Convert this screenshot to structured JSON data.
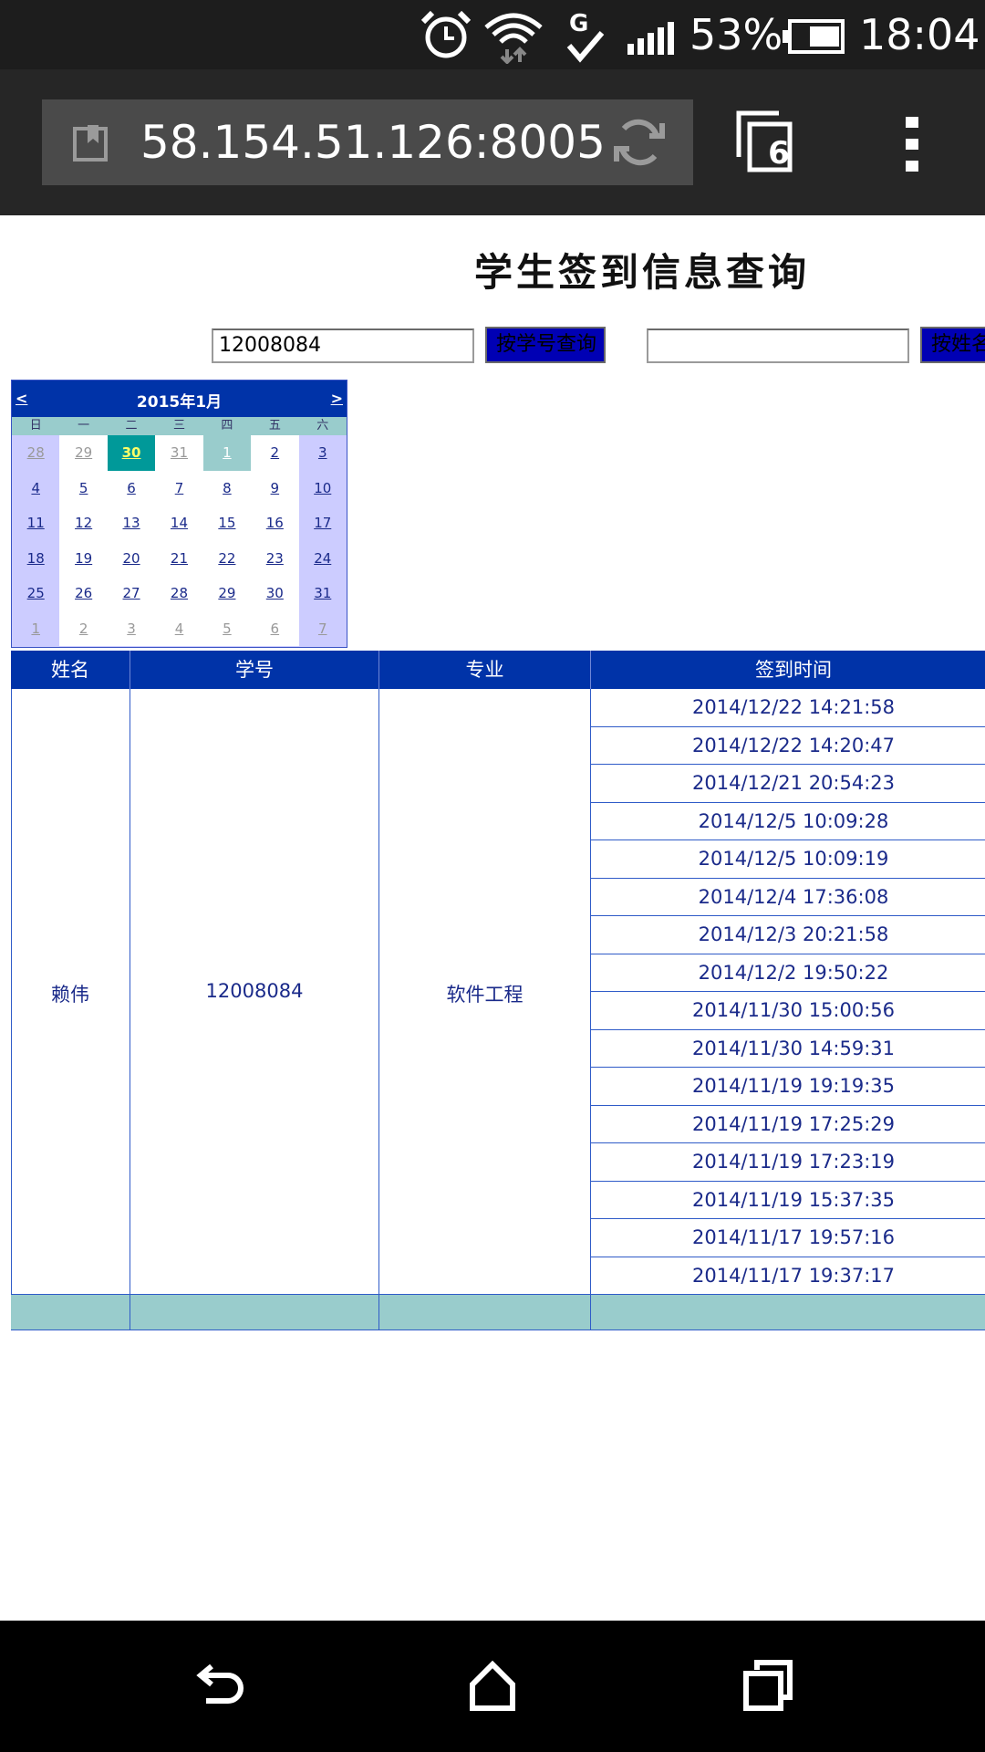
{
  "status_bar": {
    "battery_percent": "53%",
    "time": "18:04",
    "icons": [
      "alarm-icon",
      "wifi-icon",
      "g-data-icon",
      "signal-icon",
      "battery-icon"
    ]
  },
  "browser": {
    "url": "58.154.51.126:8005",
    "tab_count": "6",
    "icons": [
      "bookmark-icon",
      "reload-icon",
      "tabs-icon",
      "more-icon"
    ]
  },
  "page": {
    "title": "学生签到信息查询",
    "student_id_input": "12008084",
    "search_by_id_button": "按学号查询",
    "name_input": "",
    "search_by_name_button": "按姓名查询"
  },
  "calendar": {
    "prev": "<",
    "next": ">",
    "title": "2015年1月",
    "weekdays": [
      "日",
      "一",
      "二",
      "三",
      "四",
      "五",
      "六"
    ],
    "weeks": [
      [
        "28",
        "29",
        "30",
        "31",
        "1",
        "2",
        "3"
      ],
      [
        "4",
        "5",
        "6",
        "7",
        "8",
        "9",
        "10"
      ],
      [
        "11",
        "12",
        "13",
        "14",
        "15",
        "16",
        "17"
      ],
      [
        "18",
        "19",
        "20",
        "21",
        "22",
        "23",
        "24"
      ],
      [
        "25",
        "26",
        "27",
        "28",
        "29",
        "30",
        "31"
      ],
      [
        "1",
        "2",
        "3",
        "4",
        "5",
        "6",
        "7"
      ]
    ],
    "selected_day": "30",
    "today": "1"
  },
  "table": {
    "headers": [
      "姓名",
      "学号",
      "专业",
      "签到时间"
    ],
    "name": "赖伟",
    "student_id": "12008084",
    "major": "软件工程",
    "signin_times": [
      "2014/12/22 14:21:58",
      "2014/12/22 14:20:47",
      "2014/12/21 20:54:23",
      "2014/12/5 10:09:28",
      "2014/12/5 10:09:19",
      "2014/12/4 17:36:08",
      "2014/12/3 20:21:58",
      "2014/12/2 19:50:22",
      "2014/11/30 15:00:56",
      "2014/11/30 14:59:31",
      "2014/11/19 19:19:35",
      "2014/11/19 17:25:29",
      "2014/11/19 17:23:19",
      "2014/11/19 15:37:35",
      "2014/11/17 19:57:16",
      "2014/11/17 19:37:17"
    ]
  },
  "navigation_bar": {
    "icons": [
      "back-icon",
      "home-icon",
      "recents-icon"
    ]
  },
  "colors": {
    "header_blue": "#0033a8",
    "calendar_weekend": "#ccccff",
    "calendar_selected": "#009999",
    "footer_teal": "#99cccc",
    "button_blue": "#0000b4"
  }
}
